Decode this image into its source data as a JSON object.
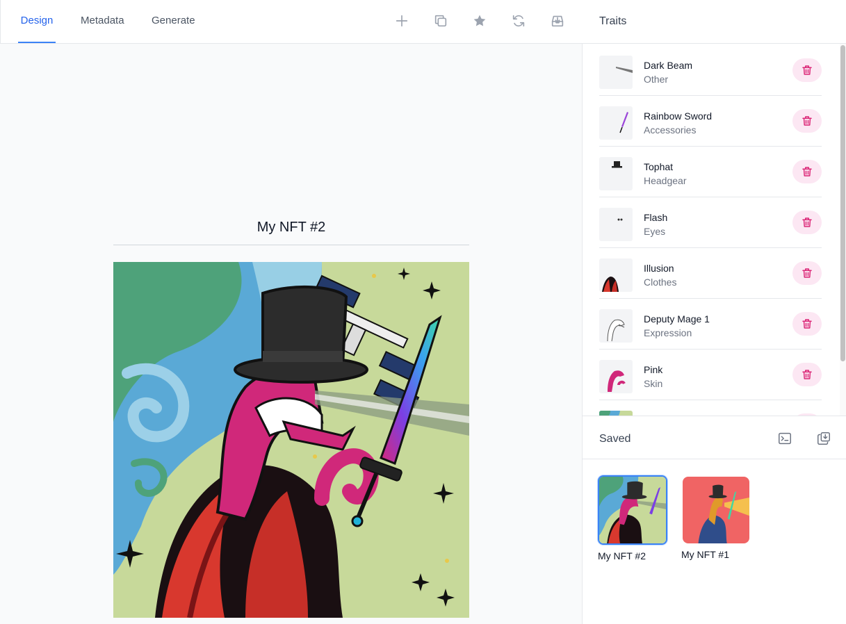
{
  "tabs": [
    {
      "label": "Design",
      "active": true
    },
    {
      "label": "Metadata",
      "active": false
    },
    {
      "label": "Generate",
      "active": false
    }
  ],
  "toolbar_icons": [
    "plus-icon",
    "duplicate-icon",
    "star-icon",
    "refresh-icon",
    "download-icon"
  ],
  "canvas": {
    "title": "My NFT #2"
  },
  "traits_panel": {
    "title": "Traits",
    "items": [
      {
        "name": "Dark Beam",
        "category": "Other"
      },
      {
        "name": "Rainbow Sword",
        "category": "Accessories"
      },
      {
        "name": "Tophat",
        "category": "Headgear"
      },
      {
        "name": "Flash",
        "category": "Eyes"
      },
      {
        "name": "Illusion",
        "category": "Clothes"
      },
      {
        "name": "Deputy Mage 1",
        "category": "Expression"
      },
      {
        "name": "Pink",
        "category": "Skin"
      }
    ]
  },
  "saved_panel": {
    "title": "Saved",
    "items": [
      {
        "label": "My NFT #2",
        "selected": true
      },
      {
        "label": "My NFT #1",
        "selected": false
      }
    ]
  },
  "colors": {
    "accent": "#2563eb",
    "delete_bg": "#fce7f3",
    "delete_icon": "#db2777",
    "skin_pink": "#d0287a",
    "background_green": "#c7d99a"
  }
}
